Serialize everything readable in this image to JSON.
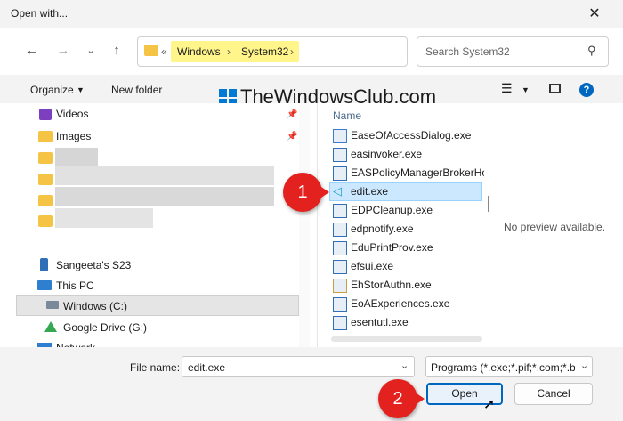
{
  "window": {
    "title": "Open with..."
  },
  "toolbar": {
    "organize_label": "Organize",
    "new_folder_label": "New folder"
  },
  "address": {
    "overflow_marker": "«",
    "crumbs": [
      "Windows",
      "System32"
    ]
  },
  "search": {
    "placeholder": "Search System32"
  },
  "watermark": "TheWindowsClub.com",
  "nav": {
    "items": [
      "Videos",
      "Images",
      "Sangeeta's S23",
      "This PC",
      "Windows (C:)",
      "Google Drive (G:)",
      "Network"
    ]
  },
  "files": {
    "column_name": "Name",
    "items": [
      "EaseOfAccessDialog.exe",
      "easinvoker.exe",
      "EASPolicyManagerBrokerHost.exe",
      "edit.exe",
      "EDPCleanup.exe",
      "edpnotify.exe",
      "EduPrintProv.exe",
      "efsui.exe",
      "EhStorAuthn.exe",
      "EoAExperiences.exe",
      "esentutl.exe"
    ],
    "selected": "edit.exe"
  },
  "preview": {
    "text": "No preview available."
  },
  "bottom": {
    "file_name_label": "File name:",
    "file_name_value": "edit.exe",
    "file_type_value": "Programs (*.exe;*.pif;*.com;*.bat;*.cmd)",
    "open_label": "Open",
    "cancel_label": "Cancel"
  },
  "annotations": {
    "one": "1",
    "two": "2"
  },
  "colors": {
    "accent": "#0067c0",
    "highlight": "#fff58a",
    "badge": "#e3211e",
    "selection": "#cce8ff"
  }
}
